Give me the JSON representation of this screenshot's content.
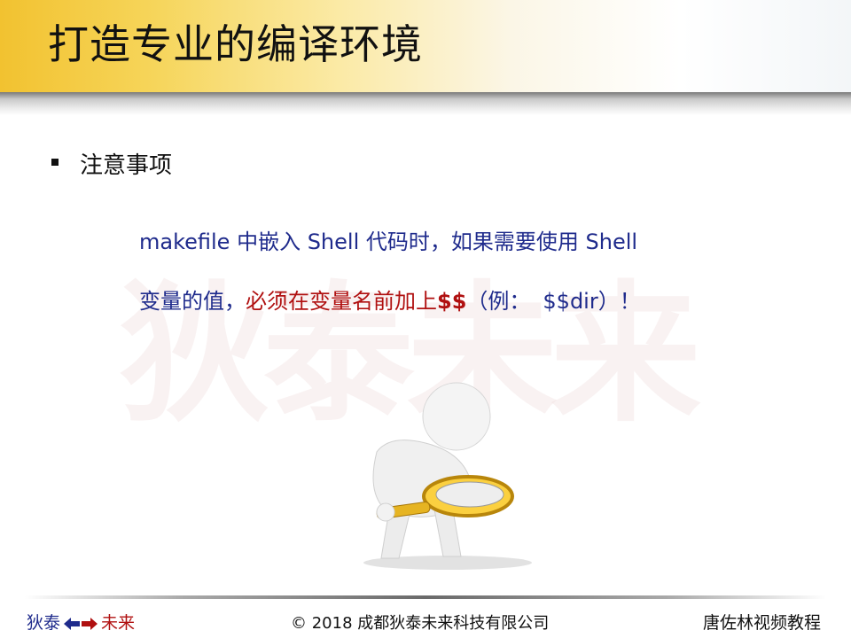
{
  "slide": {
    "title": "打造专业的编译环境",
    "bullet": "注意事项",
    "watermark": "狄泰未来",
    "line1": {
      "part1": "makefile 中嵌入 Shell 代码时，",
      "part2": "如果需要使用 Shell"
    },
    "line2": {
      "part1": "变量的值，",
      "part2": "必须在变量名前加上",
      "part3": "$$",
      "part4": "（例：",
      "part5": "$$dir",
      "part6": "）！"
    }
  },
  "footer": {
    "left1": "狄泰",
    "left2": "未来",
    "center": "© 2018 成都狄泰未来科技有限公司",
    "right": "唐佐林视频教程"
  },
  "colors": {
    "accent_yellow": "#f2c230",
    "text_blue": "#1f2b8c",
    "text_red": "#b01010"
  },
  "icons": [
    "square-bullet-icon",
    "double-arrow-icon",
    "magnifier-figure-icon"
  ]
}
